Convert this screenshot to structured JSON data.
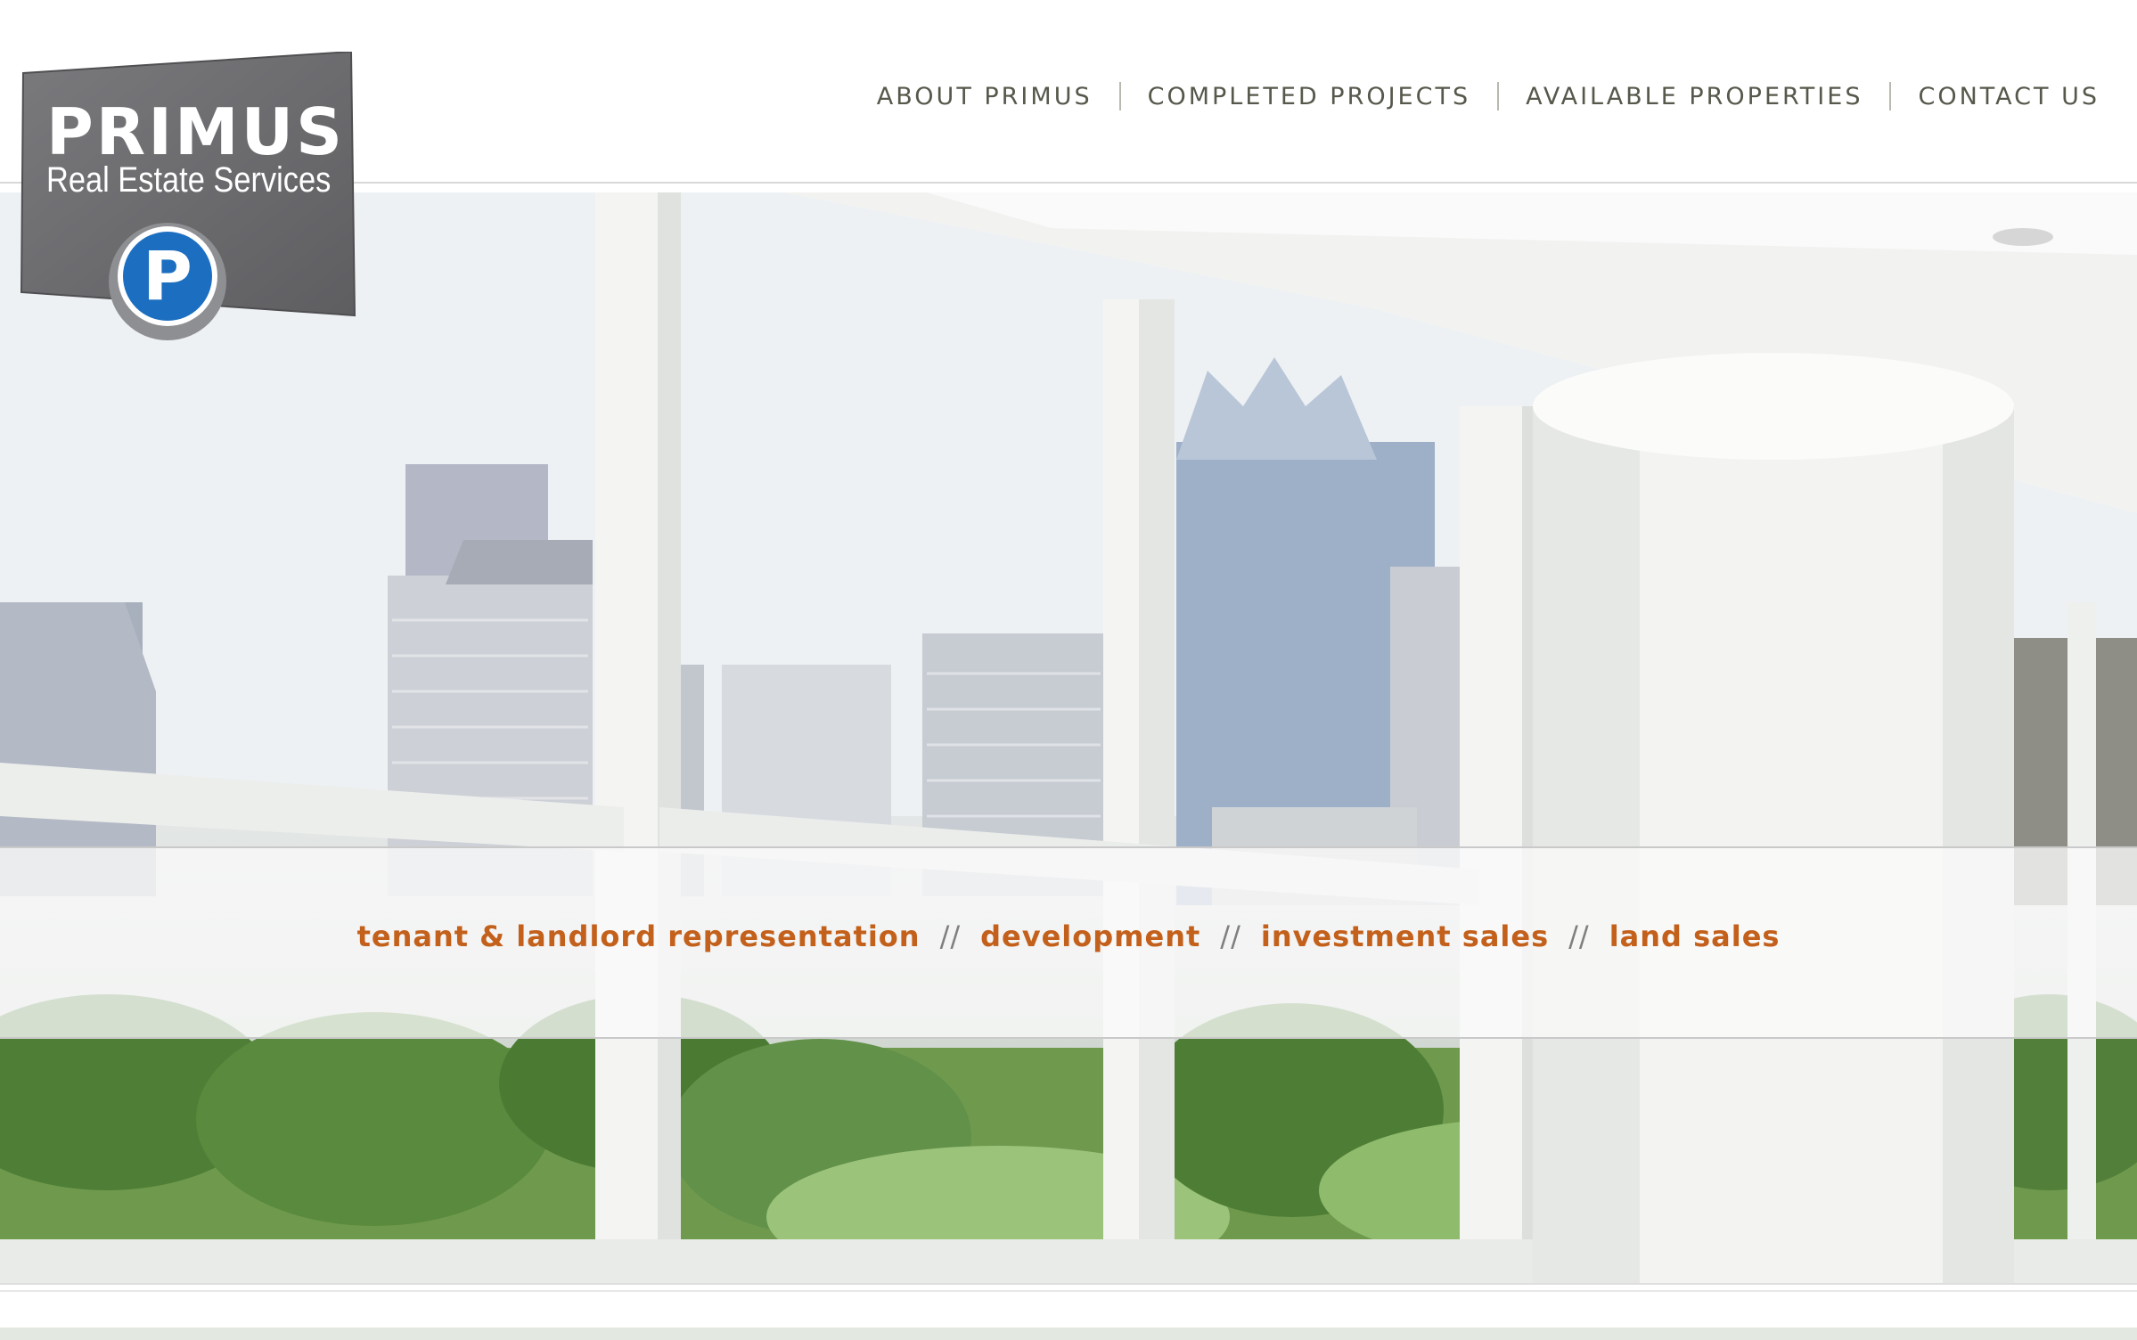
{
  "brand": {
    "name": "PRIMUS",
    "tagline": "Real Estate Services",
    "mark_letter": "P",
    "colors": {
      "badge": "#6f6f72",
      "mark_blue": "#1c6fc0",
      "accent_orange": "#c3601b"
    }
  },
  "nav": {
    "items": [
      {
        "label": "ABOUT PRIMUS"
      },
      {
        "label": "COMPLETED PROJECTS"
      },
      {
        "label": "AVAILABLE PROPERTIES"
      },
      {
        "label": "CONTACT US"
      }
    ]
  },
  "hero": {
    "services": [
      "tenant & landlord representation",
      "development",
      "investment sales",
      "land sales"
    ],
    "separator": "//"
  }
}
